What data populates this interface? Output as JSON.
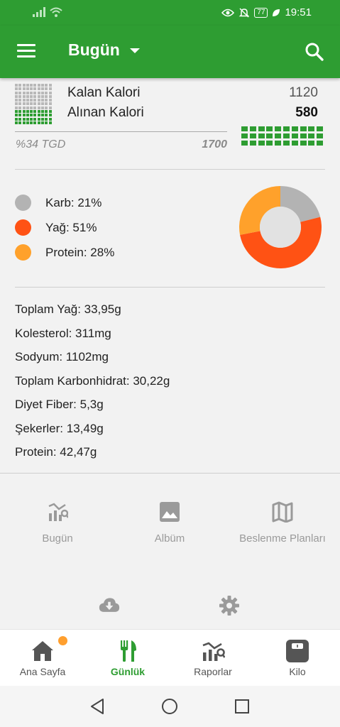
{
  "status_bar": {
    "battery": "77",
    "time": "19:51"
  },
  "app_bar": {
    "title": "Bugün"
  },
  "calories": {
    "remaining_label": "Kalan Kalori",
    "remaining_value": "1120",
    "consumed_label": "Alınan Kalori",
    "consumed_value": "580",
    "tgd_label": "%34 TGD",
    "target_value": "1700"
  },
  "macros": [
    {
      "label": "Karb: 21%",
      "color": "#b3b3b3",
      "percent": 21
    },
    {
      "label": "Yağ: 51%",
      "color": "#ff5214",
      "percent": 51
    },
    {
      "label": "Protein: 28%",
      "color": "#ffa12b",
      "percent": 28
    }
  ],
  "nutrients": [
    "Toplam Yağ: 33,95g",
    "Kolesterol: 311mg",
    "Sodyum: 1102mg",
    "Toplam Karbonhidrat: 30,22g",
    "Diyet Fiber: 5,3g",
    "Şekerler: 13,49g",
    "Protein: 42,47g"
  ],
  "shortcuts": [
    {
      "label": "Bugün",
      "icon": "chart-icon"
    },
    {
      "label": "Albüm",
      "icon": "image-icon"
    },
    {
      "label": "Beslenme Planları",
      "icon": "map-icon"
    },
    {
      "label": "",
      "icon": "cloud-download-icon"
    },
    {
      "label": "",
      "icon": "settings-icon"
    }
  ],
  "bottom_nav": [
    {
      "label": "Ana Sayfa",
      "icon": "home-icon"
    },
    {
      "label": "Günlük",
      "icon": "cutlery-icon",
      "active": true
    },
    {
      "label": "Raporlar",
      "icon": "chart-icon"
    },
    {
      "label": "Kilo",
      "icon": "scale-icon"
    }
  ],
  "colors": {
    "primary": "#2e9d32",
    "accent_orange": "#ffa12b",
    "fat_red": "#ff5214",
    "carb_grey": "#b3b3b3"
  }
}
